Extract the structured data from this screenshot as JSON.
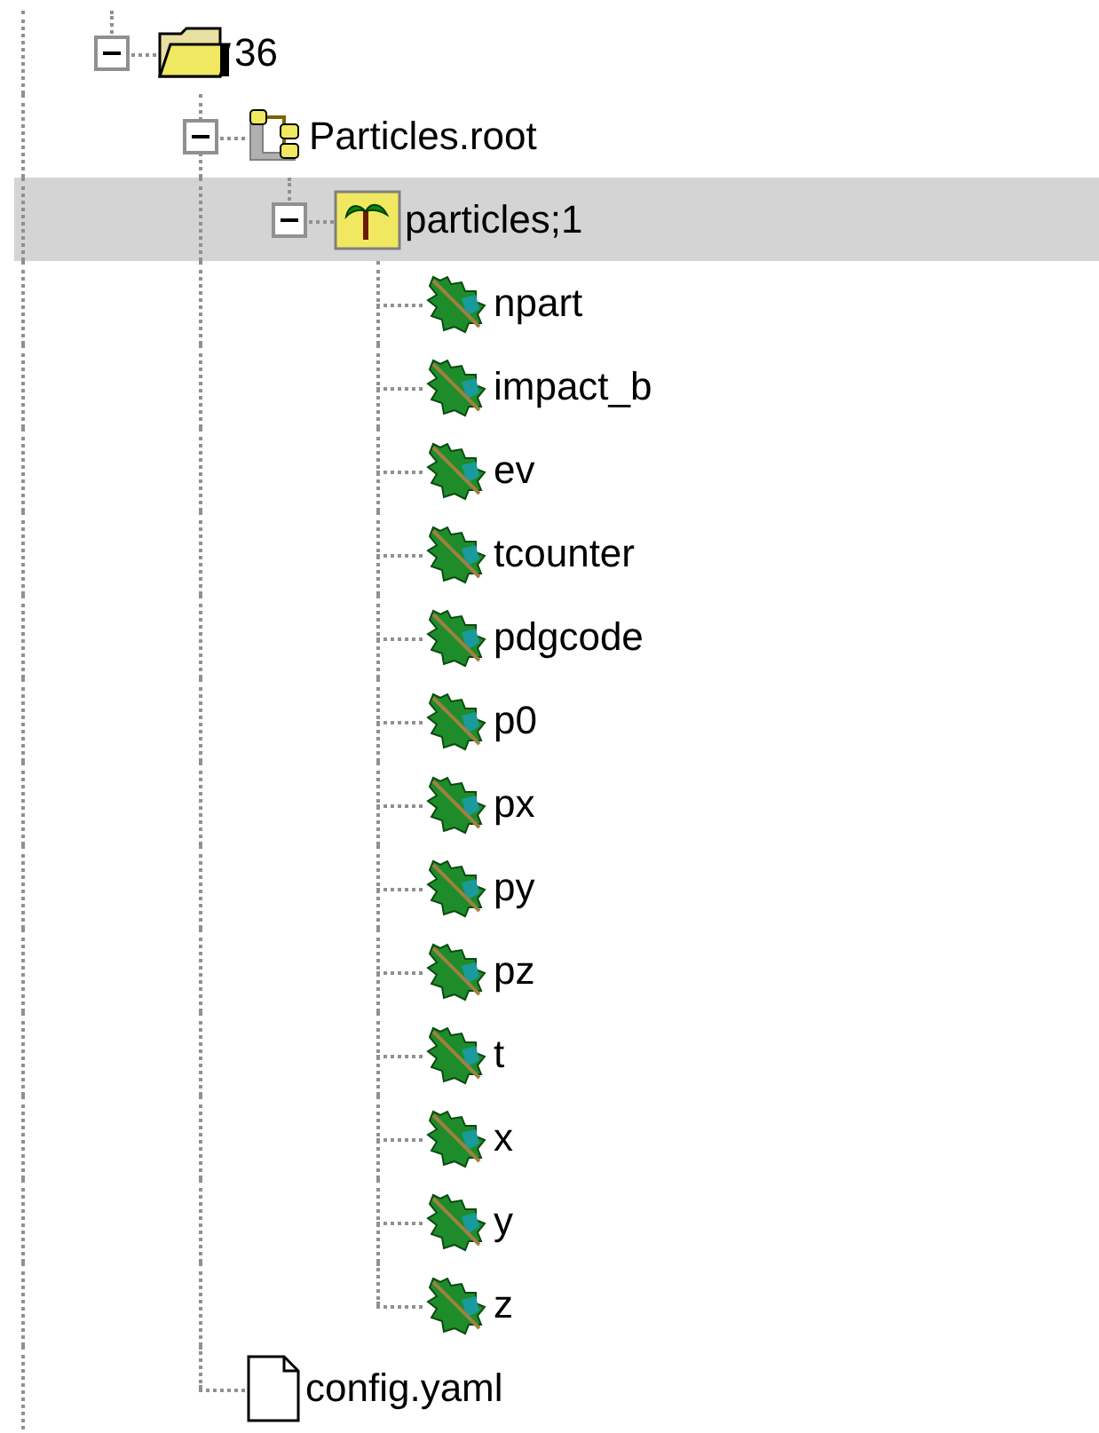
{
  "tree": [
    {
      "label": "36",
      "kind": "folder",
      "expanded": true,
      "selected": false,
      "children": [
        {
          "label": "Particles.root",
          "kind": "rootfile",
          "expanded": true,
          "selected": false,
          "children": [
            {
              "label": "particles;1",
              "kind": "tree",
              "expanded": true,
              "selected": true,
              "children": [
                {
                  "label": "npart",
                  "kind": "leaf",
                  "selected": false
                },
                {
                  "label": "impact_b",
                  "kind": "leaf",
                  "selected": false
                },
                {
                  "label": "ev",
                  "kind": "leaf",
                  "selected": false
                },
                {
                  "label": "tcounter",
                  "kind": "leaf",
                  "selected": false
                },
                {
                  "label": "pdgcode",
                  "kind": "leaf",
                  "selected": false
                },
                {
                  "label": "p0",
                  "kind": "leaf",
                  "selected": false
                },
                {
                  "label": "px",
                  "kind": "leaf",
                  "selected": false
                },
                {
                  "label": "py",
                  "kind": "leaf",
                  "selected": false
                },
                {
                  "label": "pz",
                  "kind": "leaf",
                  "selected": false
                },
                {
                  "label": "t",
                  "kind": "leaf",
                  "selected": false
                },
                {
                  "label": "x",
                  "kind": "leaf",
                  "selected": false
                },
                {
                  "label": "y",
                  "kind": "leaf",
                  "selected": false
                },
                {
                  "label": "z",
                  "kind": "leaf",
                  "selected": false
                }
              ]
            }
          ]
        },
        {
          "label": "config.yaml",
          "kind": "file",
          "selected": false
        }
      ]
    }
  ]
}
